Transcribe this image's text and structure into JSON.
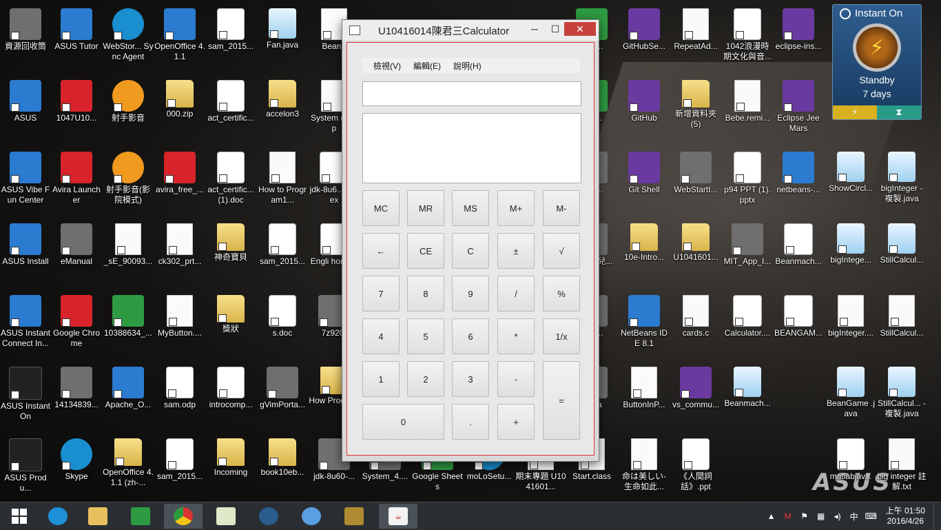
{
  "desktop": {
    "icons": [
      {
        "label": "資源回收筒",
        "kind": "gray"
      },
      {
        "label": "ASUS Tutor",
        "kind": "app"
      },
      {
        "label": "WebStor... Sync Agent",
        "kind": "cyan"
      },
      {
        "label": "OpenOffice 4.1.1",
        "kind": "app"
      },
      {
        "label": "sam_2015...",
        "kind": "doc"
      },
      {
        "label": "Fan.java",
        "kind": "note"
      },
      {
        "label": "BeanF",
        "kind": "file"
      },
      {
        "label": "...50...",
        "kind": "green"
      },
      {
        "label": "GitHubSe...",
        "kind": "purple"
      },
      {
        "label": "RepeatAd...",
        "kind": "file"
      },
      {
        "label": "1042浪漫時期文化與音...",
        "kind": "doc"
      },
      {
        "label": "eclipse-ins...",
        "kind": "purple"
      },
      {
        "label": "ASUS",
        "kind": "app"
      },
      {
        "label": "1047U10...",
        "kind": "red"
      },
      {
        "label": "射手影音",
        "kind": "orange"
      },
      {
        "label": "000.zip",
        "kind": "folder"
      },
      {
        "label": "act_certific...",
        "kind": "doc"
      },
      {
        "label": "accelon3",
        "kind": "folder"
      },
      {
        "label": "System (1).ap",
        "kind": "file"
      },
      {
        "label": "...bi...",
        "kind": "green"
      },
      {
        "label": "GitHub",
        "kind": "purple"
      },
      {
        "label": "新增資料夾 (5)",
        "kind": "folder"
      },
      {
        "label": "Bebe.remi...",
        "kind": "file"
      },
      {
        "label": "Eclipse Jee Mars",
        "kind": "purple"
      },
      {
        "label": "ASUS  Vibe Fun Center",
        "kind": "app"
      },
      {
        "label": "Avira Launcher",
        "kind": "red"
      },
      {
        "label": "射手影音(影院模式)",
        "kind": "orange"
      },
      {
        "label": "avira_free_...",
        "kind": "red"
      },
      {
        "label": "act_certific... (1).doc",
        "kind": "doc"
      },
      {
        "label": "How to Program1...",
        "kind": "file"
      },
      {
        "label": "jdk-8u6... (2).ex",
        "kind": "java"
      },
      {
        "label": "...ps...",
        "kind": "gray"
      },
      {
        "label": "Git Shell",
        "kind": "purple"
      },
      {
        "label": "WebStartI...",
        "kind": "gray"
      },
      {
        "label": "p94 PPT (1).pptx",
        "kind": "doc"
      },
      {
        "label": "netbeans-...",
        "kind": "app"
      },
      {
        "label": "ShowCircl...",
        "kind": "note"
      },
      {
        "label": "bigInteger - 複製.java",
        "kind": "note"
      },
      {
        "label": "ASUS Install",
        "kind": "app"
      },
      {
        "label": "eManual",
        "kind": "gray"
      },
      {
        "label": "_sE_90093...",
        "kind": "file"
      },
      {
        "label": "ck302_prt...",
        "kind": "file"
      },
      {
        "label": "神奇寶貝",
        "kind": "folder"
      },
      {
        "label": "sam_2015...",
        "kind": "doc"
      },
      {
        "label": "Engli homew",
        "kind": "doc"
      },
      {
        "label": "...m 上 兒...",
        "kind": "gray"
      },
      {
        "label": "10e-Intro...",
        "kind": "folder"
      },
      {
        "label": "U1041601...",
        "kind": "folder"
      },
      {
        "label": "MIT_App_I...",
        "kind": "gray"
      },
      {
        "label": "Beanmach...",
        "kind": "java"
      },
      {
        "label": "bigIntege...",
        "kind": "note"
      },
      {
        "label": "StillCalcul...",
        "kind": "note"
      },
      {
        "label": "ASUS Instant Connect In...",
        "kind": "app"
      },
      {
        "label": "Google Chrome",
        "kind": "red"
      },
      {
        "label": "10388634_...",
        "kind": "green"
      },
      {
        "label": "MyButton....",
        "kind": "file"
      },
      {
        "label": "獎狀",
        "kind": "folder"
      },
      {
        "label": "s.doc",
        "kind": "doc"
      },
      {
        "label": "7z920-",
        "kind": "gray"
      },
      {
        "label": "...6d...",
        "kind": "gray"
      },
      {
        "label": "NetBeans IDE 8.1",
        "kind": "app"
      },
      {
        "label": "cards.c",
        "kind": "file"
      },
      {
        "label": "Calculator....",
        "kind": "java"
      },
      {
        "label": "BEANGAM...",
        "kind": "java"
      },
      {
        "label": "bigInteger....",
        "kind": "file"
      },
      {
        "label": "StillCalcul...",
        "kind": "file"
      },
      {
        "label": "ASUS InstantOn",
        "kind": "black"
      },
      {
        "label": "14134839...",
        "kind": "gray"
      },
      {
        "label": "Apache_O...",
        "kind": "app"
      },
      {
        "label": "sam.odp",
        "kind": "doc"
      },
      {
        "label": "introcomp...",
        "kind": "doc"
      },
      {
        "label": "gVimPorta...",
        "kind": "gray"
      },
      {
        "label": "How Program",
        "kind": "folder"
      },
      {
        "label": "...ava",
        "kind": "gray"
      },
      {
        "label": "ButtonInP...",
        "kind": "file"
      },
      {
        "label": "vs_commu...",
        "kind": "purple"
      },
      {
        "label": "Beanmach...",
        "kind": "note"
      },
      {
        "label": "BeanGame .java",
        "kind": "note"
      },
      {
        "label": "StillCalcul... - 複製.java",
        "kind": "note"
      },
      {
        "label": "ASUS Produ...",
        "kind": "black"
      },
      {
        "label": "Skype",
        "kind": "cyan"
      },
      {
        "label": "OpenOffice 4.1.1 (zh-...",
        "kind": "folder"
      },
      {
        "label": "sam_2015...",
        "kind": "doc"
      },
      {
        "label": "Incoming",
        "kind": "folder"
      },
      {
        "label": "book10eb...",
        "kind": "folder"
      },
      {
        "label": "jdk-8u60-...",
        "kind": "gray"
      },
      {
        "label": "System_4....",
        "kind": "gray"
      },
      {
        "label": "Google Sheets",
        "kind": "green"
      },
      {
        "label": "moLoSetu...",
        "kind": "cyan"
      },
      {
        "label": "期末專題 U1041601...",
        "kind": "file"
      },
      {
        "label": "Start.class",
        "kind": "file"
      },
      {
        "label": "命は美しい-生命如此...",
        "kind": "file"
      },
      {
        "label": "《人間詞話》.ppt",
        "kind": "doc"
      },
      {
        "label": "matlabjav...",
        "kind": "doc"
      },
      {
        "label": "big integer 註解.txt",
        "kind": "file"
      }
    ]
  },
  "gadget": {
    "title": "Instant On",
    "status": "Standby",
    "days": "7 days"
  },
  "calculator": {
    "title": "U10416014陳君三Calculator",
    "menu": [
      "檢視(V)",
      "編輯(E)",
      "說明(H)"
    ],
    "keys": {
      "mc": "MC",
      "mr": "MR",
      "ms": "MS",
      "mplus": "M+",
      "mminus": "M-",
      "back": "←",
      "ce": "CE",
      "c": "C",
      "pm": "±",
      "sqrt": "√",
      "k7": "7",
      "k8": "8",
      "k9": "9",
      "div": "/",
      "pct": "%",
      "k4": "4",
      "k5": "5",
      "k6": "6",
      "mul": "*",
      "inv": "1/x",
      "k1": "1",
      "k2": "2",
      "k3": "3",
      "sub": "-",
      "eq": "=",
      "k0": "0",
      "dot": ".",
      "add": "+"
    }
  },
  "taskbar": {
    "clock_time": "上午 01:50",
    "clock_date": "2016/4/26",
    "ime": "中"
  }
}
